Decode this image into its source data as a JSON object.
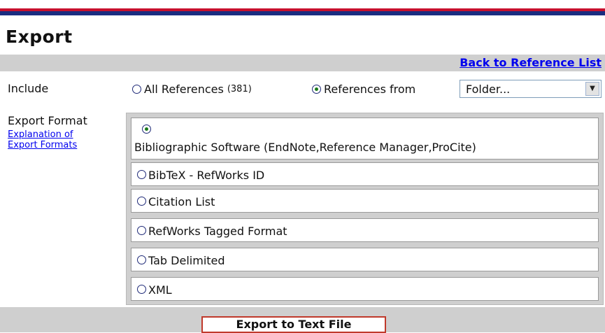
{
  "header": {
    "title": "Export"
  },
  "nav": {
    "back_link": "Back to Reference List"
  },
  "include": {
    "label": "Include",
    "all_refs_label": "All References",
    "all_refs_count": "(381)",
    "refs_from_label": "References from",
    "folder_select": {
      "selected": "Folder..."
    }
  },
  "export_format": {
    "label": "Export Format",
    "explanation_line1": "Explanation of",
    "explanation_line2": "Export Formats",
    "options": [
      {
        "label": "Bibliographic Software (EndNote,Reference Manager,ProCite)",
        "checked": true
      },
      {
        "label": "BibTeX - RefWorks ID",
        "checked": false
      },
      {
        "label": "Citation List",
        "checked": false
      },
      {
        "label": "RefWorks Tagged Format",
        "checked": false
      },
      {
        "label": "Tab Delimited",
        "checked": false
      },
      {
        "label": "XML",
        "checked": false
      }
    ]
  },
  "actions": {
    "export_button": "Export to Text File"
  },
  "colors": {
    "accent_red": "#c8102e",
    "accent_blue": "#1a2d80",
    "panel_gray": "#cfcfcf",
    "link_blue": "#0000ee"
  }
}
